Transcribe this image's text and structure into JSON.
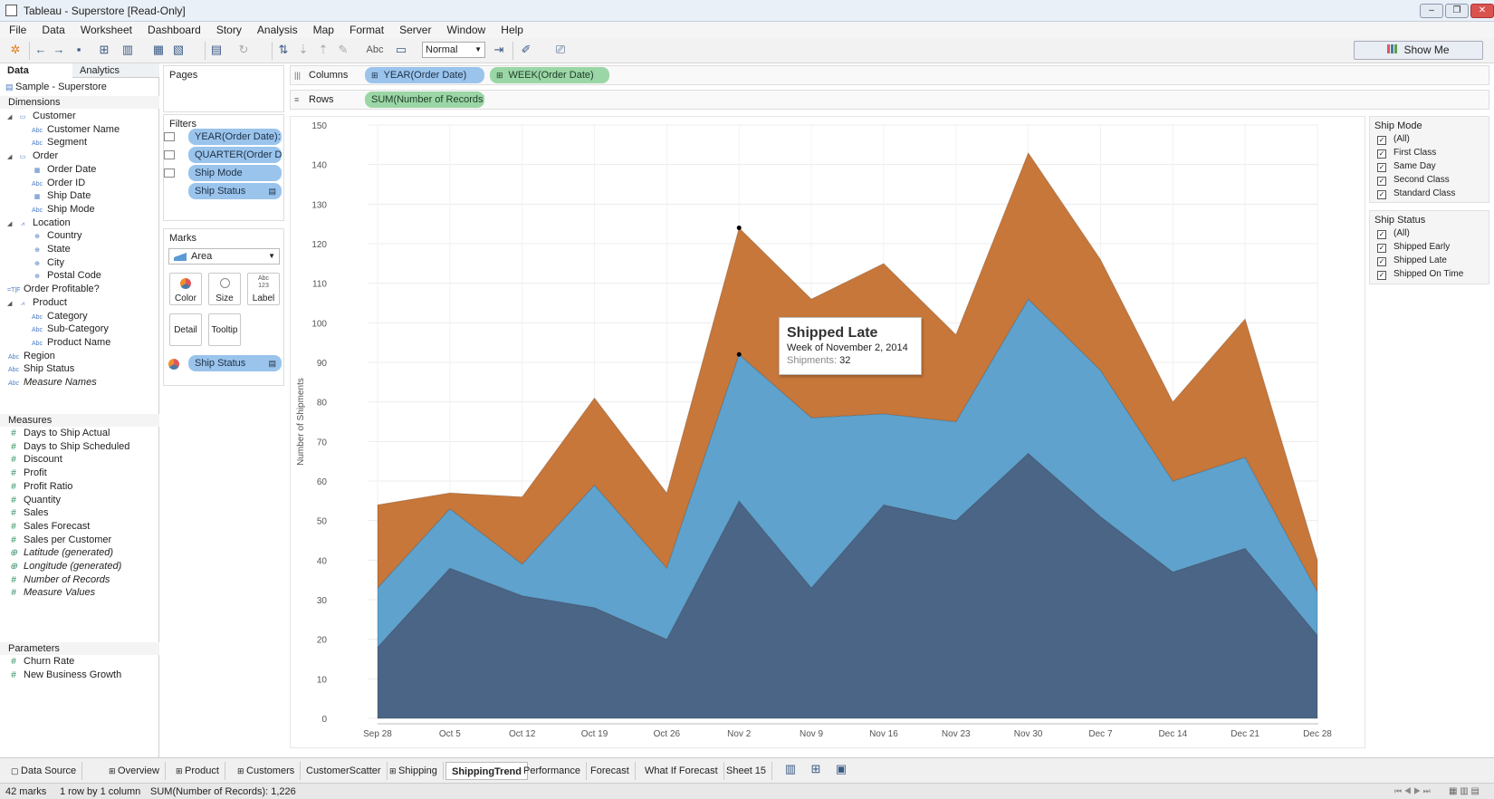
{
  "window": {
    "title": "Tableau - Superstore [Read-Only]"
  },
  "menu": [
    "File",
    "Data",
    "Worksheet",
    "Dashboard",
    "Story",
    "Analysis",
    "Map",
    "Format",
    "Server",
    "Window",
    "Help"
  ],
  "toolbar": {
    "label_tool": "Abc",
    "fit_value": "Normal",
    "show_me": "Show Me"
  },
  "left_pane": {
    "tab_data": "Data",
    "tab_analytics": "Analytics",
    "datasource": "Sample - Superstore",
    "dimensions_header": "Dimensions",
    "dimensions": [
      {
        "label": "Customer",
        "kind": "folder",
        "indent": 0
      },
      {
        "label": "Customer Name",
        "kind": "Abc",
        "indent": 1
      },
      {
        "label": "Segment",
        "kind": "Abc",
        "indent": 1
      },
      {
        "label": "Order",
        "kind": "folder",
        "indent": 0
      },
      {
        "label": "Order Date",
        "kind": "date",
        "indent": 1
      },
      {
        "label": "Order ID",
        "kind": "Abc",
        "indent": 1
      },
      {
        "label": "Ship Date",
        "kind": "date",
        "indent": 1
      },
      {
        "label": "Ship Mode",
        "kind": "Abc",
        "indent": 1
      },
      {
        "label": "Location",
        "kind": "hier",
        "indent": 0
      },
      {
        "label": "Country",
        "kind": "geo",
        "indent": 1
      },
      {
        "label": "State",
        "kind": "geo",
        "indent": 1
      },
      {
        "label": "City",
        "kind": "geo",
        "indent": 1
      },
      {
        "label": "Postal Code",
        "kind": "geo",
        "indent": 1
      },
      {
        "label": "Order Profitable?",
        "kind": "TF",
        "indent": 0
      },
      {
        "label": "Product",
        "kind": "hier",
        "indent": 0
      },
      {
        "label": "Category",
        "kind": "Abc",
        "indent": 1
      },
      {
        "label": "Sub-Category",
        "kind": "Abc",
        "indent": 1
      },
      {
        "label": "Product Name",
        "kind": "Abc",
        "indent": 1
      },
      {
        "label": "Region",
        "kind": "Abc",
        "indent": 0
      },
      {
        "label": "Ship Status",
        "kind": "Abc",
        "indent": 0
      },
      {
        "label": "Measure Names",
        "kind": "Abc",
        "indent": 0,
        "italic": true
      }
    ],
    "measures_header": "Measures",
    "measures": [
      {
        "label": "Days to Ship Actual"
      },
      {
        "label": "Days to Ship Scheduled"
      },
      {
        "label": "Discount"
      },
      {
        "label": "Profit"
      },
      {
        "label": "Profit Ratio"
      },
      {
        "label": "Quantity"
      },
      {
        "label": "Sales"
      },
      {
        "label": "Sales Forecast"
      },
      {
        "label": "Sales per Customer"
      },
      {
        "label": "Latitude (generated)",
        "italic": true,
        "geo": true
      },
      {
        "label": "Longitude (generated)",
        "italic": true,
        "geo": true
      },
      {
        "label": "Number of Records",
        "italic": true
      },
      {
        "label": "Measure Values",
        "italic": true
      }
    ],
    "parameters_header": "Parameters",
    "parameters": [
      {
        "label": "Churn Rate"
      },
      {
        "label": "New Business Growth"
      }
    ]
  },
  "pages": {
    "title": "Pages"
  },
  "filters": {
    "title": "Filters",
    "items": [
      "YEAR(Order Date): ..",
      "QUARTER(Order D..",
      "Ship Mode",
      "Ship Status"
    ]
  },
  "marks": {
    "title": "Marks",
    "type": "Area",
    "buttons": [
      "Color",
      "Size",
      "Label",
      "Detail",
      "Tooltip"
    ],
    "label_glyph": "Abc\n123",
    "color_pill": "Ship Status"
  },
  "shelves": {
    "columns_label": "Columns",
    "rows_label": "Rows",
    "columns": [
      "YEAR(Order Date)",
      "WEEK(Order Date)"
    ],
    "rows": [
      "SUM(Number of Records)"
    ]
  },
  "legends": {
    "ship_mode": {
      "title": "Ship Mode",
      "items": [
        "(All)",
        "First Class",
        "Same Day",
        "Second Class",
        "Standard Class"
      ]
    },
    "ship_status": {
      "title": "Ship Status",
      "items": [
        "(All)",
        "Shipped Early",
        "Shipped Late",
        "Shipped On Time"
      ]
    }
  },
  "tooltip": {
    "title": "Shipped Late",
    "subtitle": "Week of November 2, 2014",
    "metric_label": "Shipments:",
    "metric_value": "32"
  },
  "colors": {
    "shipped_early": "#4b6587",
    "shipped_late": "#5fa2cd",
    "shipped_on_time": "#c7773a",
    "axis": "#888888",
    "grid": "#ececec"
  },
  "chart_data": {
    "type": "area",
    "stacked": true,
    "ylabel": "Number of Shipments",
    "xlabel": "",
    "ylim": [
      0,
      150
    ],
    "yticks": [
      0,
      10,
      20,
      30,
      40,
      50,
      60,
      70,
      80,
      90,
      100,
      110,
      120,
      130,
      140,
      150
    ],
    "categories": [
      "Sep 28",
      "Oct 5",
      "Oct 12",
      "Oct 19",
      "Oct 26",
      "Nov 2",
      "Nov 9",
      "Nov 16",
      "Nov 23",
      "Nov 30",
      "Dec 7",
      "Dec 14",
      "Dec 21",
      "Dec 28"
    ],
    "series": [
      {
        "values": [
          18,
          38,
          31,
          28,
          20,
          55,
          33,
          54,
          50,
          67,
          51,
          37,
          43,
          21
        ]
      },
      {
        "values": [
          15,
          15,
          8,
          31,
          18,
          37,
          43,
          23,
          25,
          39,
          37,
          23,
          23,
          11
        ]
      },
      {
        "values": [
          21,
          4,
          17,
          22,
          19,
          32,
          30,
          38,
          22,
          37,
          28,
          20,
          35,
          8
        ]
      }
    ],
    "grid": true,
    "legend": "none"
  },
  "sheet_tabs": [
    "Data Source",
    "Overview",
    "Product",
    "Customers",
    "CustomerScatter",
    "Shipping",
    "ShippingTrend",
    "Performance",
    "Forecast",
    "What If Forecast",
    "Sheet 15"
  ],
  "active_sheet": "ShippingTrend",
  "status": {
    "marks": "42 marks",
    "rowscols": "1 row by 1 column",
    "sum": "SUM(Number of Records): 1,226"
  }
}
